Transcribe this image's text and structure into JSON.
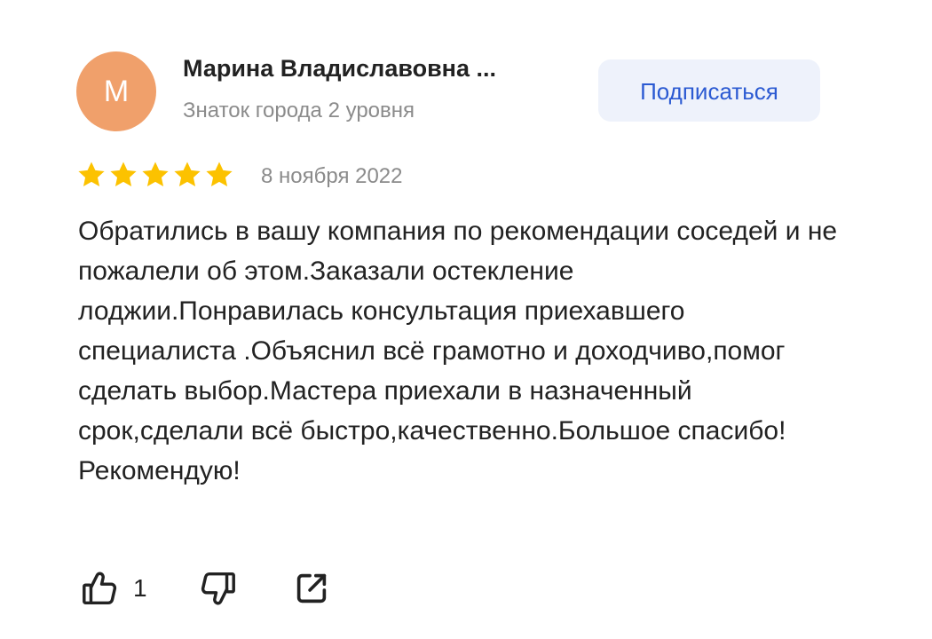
{
  "review": {
    "author": {
      "initial": "М",
      "name": "Марина Владиславовна ...",
      "level": "Знаток города 2 уровня",
      "avatar_color": "#f0a06b"
    },
    "subscribe_label": "Подписаться",
    "rating": {
      "value": 5,
      "max": 5,
      "star_color": "#fcc200"
    },
    "date": "8 ноября 2022",
    "text": "Обратились в вашу компания по рекомендации соседей и не пожалели об этом.Заказали остекление лоджии.Понравилась консультация приехавшего специалиста .Объяснил всё грамотно и доходчиво,помог сделать выбор.Мастера приехали в назначенный срок,сделали всё быстро,качественно.Большое спасибо!Рекомендую!",
    "actions": {
      "like_icon": "thumbs-up-icon",
      "like_count": "1",
      "dislike_icon": "thumbs-down-icon",
      "share_icon": "share-icon"
    },
    "accent_color": "#2b5ad2"
  }
}
